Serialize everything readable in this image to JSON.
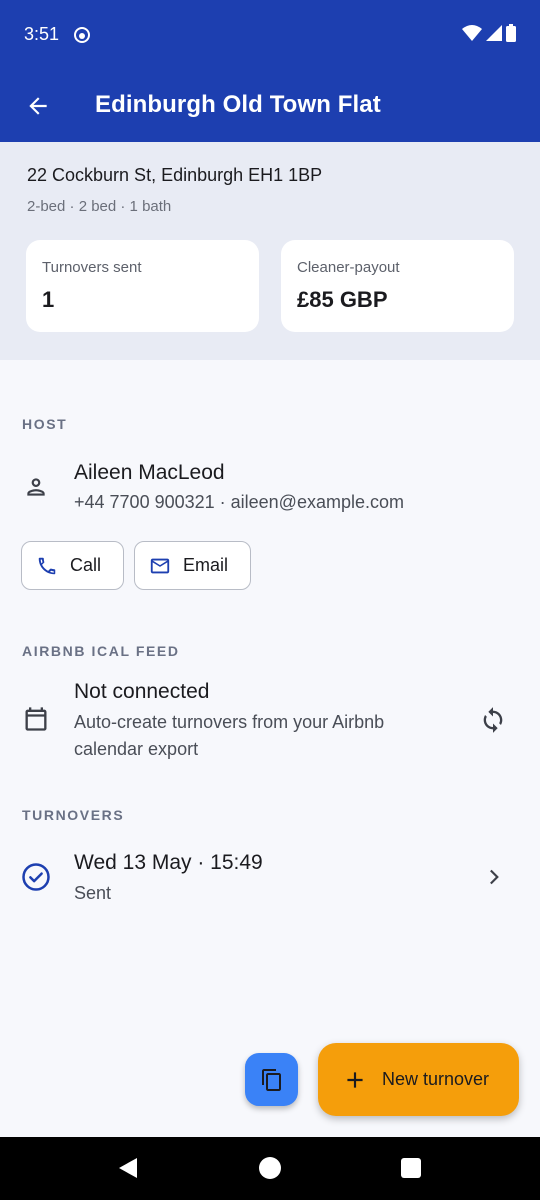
{
  "status_bar": {
    "time": "3:51"
  },
  "app_bar": {
    "title": "Edinburgh Old Town Flat"
  },
  "property": {
    "address": "22 Cockburn St, Edinburgh EH1 1BP",
    "rooms": "2-bed · 2 bed · 1 bath"
  },
  "stats": [
    {
      "label": "Turnovers sent",
      "value": "1"
    },
    {
      "label": "Cleaner-payout",
      "value": "£85 GBP"
    }
  ],
  "host": {
    "section_label": "HOST",
    "name": "Aileen MacLeod",
    "contact": "+44 7700 900321 · aileen@example.com",
    "call_label": "Call",
    "email_label": "Email"
  },
  "ical": {
    "section_label": "AIRBNB ICAL FEED",
    "title": "Not connected",
    "description": "Auto-create turnovers from your Airbnb calendar export"
  },
  "turnovers": {
    "section_label": "TURNOVERS",
    "items": [
      {
        "date": "Wed 13 May · 15:49",
        "status": "Sent"
      }
    ]
  },
  "fab": {
    "label": "New turnover"
  },
  "colors": {
    "primary": "#1d3fb0",
    "fab_primary": "#f59e0b",
    "fab_secondary": "#3a82f7",
    "surface_tint": "#e8ebf4"
  },
  "icons": {
    "back": "arrow-left-icon",
    "person": "person-icon",
    "phone": "phone-icon",
    "mail": "mail-icon",
    "calendar": "calendar-icon",
    "sync": "sync-icon",
    "check": "check-circle-icon",
    "chevron": "chevron-right-icon",
    "copy": "copy-icon",
    "add": "plus-icon"
  }
}
